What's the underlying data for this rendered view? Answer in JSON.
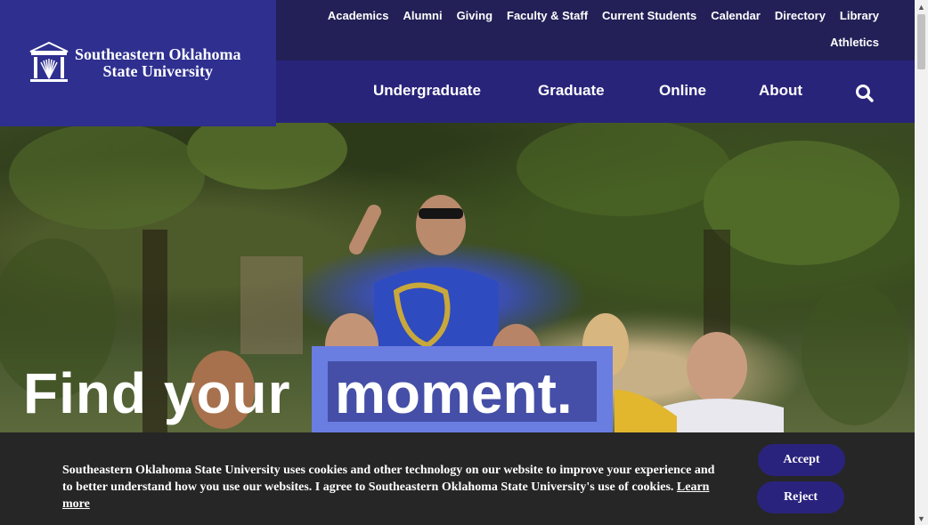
{
  "logo": {
    "line1": "Southeastern Oklahoma",
    "line2": "State University",
    "icon": "building-columns-icon"
  },
  "utility_nav": {
    "row1": [
      "Academics",
      "Alumni",
      "Giving",
      "Faculty & Staff",
      "Current Students",
      "Calendar",
      "Directory",
      "Library"
    ],
    "row2": [
      "Athletics"
    ]
  },
  "main_nav": {
    "items": [
      "Undergraduate",
      "Graduate",
      "Online",
      "About"
    ],
    "search_icon": "search-icon"
  },
  "hero": {
    "text_part1": "Find your",
    "text_part2": "moment."
  },
  "cookie_banner": {
    "message": "Southeastern Oklahoma State University uses cookies and other technology on our website to improve your experience and to better understand how you use our websites. I agree to Southeastern Oklahoma State University's use of cookies.",
    "learn_more": "Learn more",
    "accept": "Accept",
    "reject": "Reject"
  },
  "colors": {
    "logo_bg": "#2e2f8f",
    "top_bar_bg": "#222056",
    "main_nav_bg": "#28247a",
    "highlight": "#6a7de0",
    "cookie_bg": "#262626",
    "button_bg": "#2a237d"
  }
}
